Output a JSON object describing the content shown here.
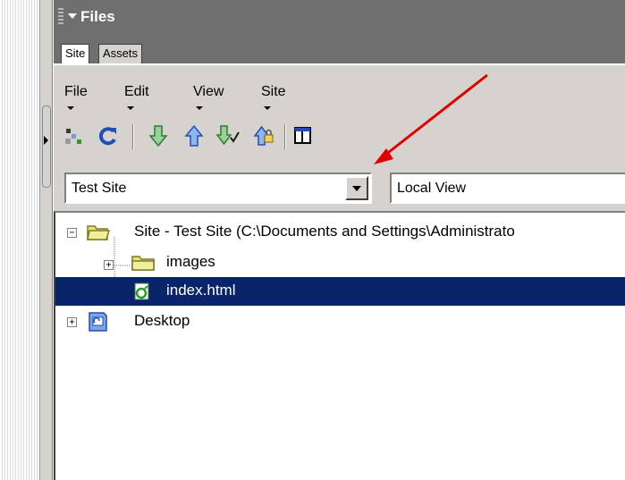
{
  "panel": {
    "title": "Files",
    "tabs": [
      {
        "label": "Site",
        "active": true
      },
      {
        "label": "Assets",
        "active": false
      }
    ]
  },
  "menubar": {
    "items": [
      {
        "label": "File"
      },
      {
        "label": "Edit"
      },
      {
        "label": "View"
      },
      {
        "label": "Site"
      }
    ]
  },
  "toolbar": {
    "buttons": [
      "connect-icon",
      "refresh-icon",
      "get-icon",
      "put-icon",
      "check-out-icon",
      "check-in-icon",
      "expand-icon"
    ]
  },
  "site_select": {
    "value": "Test Site"
  },
  "view_select": {
    "value": "Local View"
  },
  "tree": {
    "root": {
      "label": "Site - Test Site (C:\\Documents and Settings\\Administrato",
      "expanded": true
    },
    "children": [
      {
        "label": "images",
        "expanded": false,
        "type": "folder"
      },
      {
        "label": "index.html",
        "selected": true,
        "type": "file"
      }
    ],
    "desktop": {
      "label": "Desktop",
      "expanded": false
    }
  },
  "colors": {
    "selection": "#0a246a",
    "panel_header": "#6f6f6f",
    "folder": "#e8e36a",
    "annotation_arrow": "#e00000",
    "toolbar_arrows": "#2e9a2e"
  }
}
